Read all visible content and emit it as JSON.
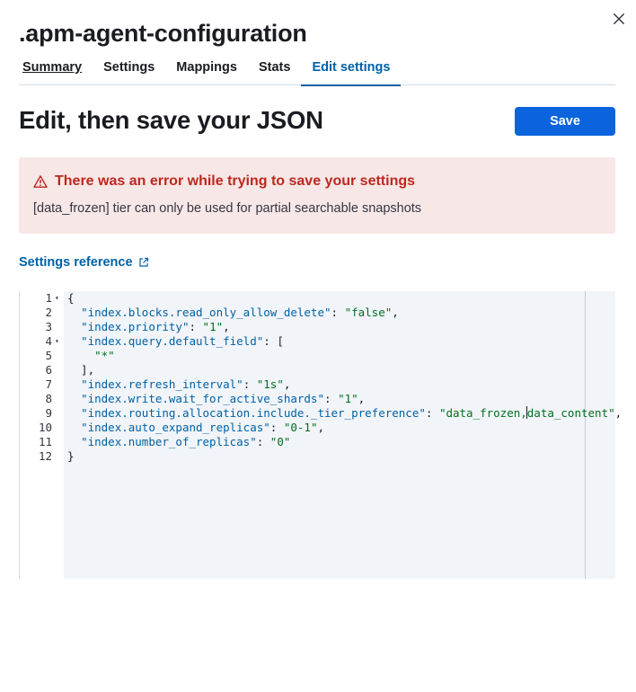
{
  "flyout": {
    "title": ".apm-agent-configuration",
    "close_icon": "close-icon"
  },
  "tabs": [
    {
      "label": "Summary",
      "state": "underlined"
    },
    {
      "label": "Settings",
      "state": "normal"
    },
    {
      "label": "Mappings",
      "state": "normal"
    },
    {
      "label": "Stats",
      "state": "normal"
    },
    {
      "label": "Edit settings",
      "state": "selected"
    }
  ],
  "page": {
    "title": "Edit, then save your JSON",
    "save_label": "Save"
  },
  "error_callout": {
    "icon": "warning-icon",
    "title": "There was an error while trying to save your settings",
    "message": "[data_frozen] tier can only be used for partial searchable snapshots"
  },
  "settings_reference": {
    "label": "Settings reference",
    "icon": "external-link-icon"
  },
  "editor": {
    "lines": [
      {
        "num": "1",
        "fold": true,
        "tokens": [
          [
            "p",
            "{"
          ]
        ]
      },
      {
        "num": "2",
        "fold": false,
        "tokens": [
          [
            "p",
            "  "
          ],
          [
            "k",
            "\"index.blocks.read_only_allow_delete\""
          ],
          [
            "p",
            ": "
          ],
          [
            "s",
            "\"false\""
          ],
          [
            "p",
            ","
          ]
        ]
      },
      {
        "num": "3",
        "fold": false,
        "tokens": [
          [
            "p",
            "  "
          ],
          [
            "k",
            "\"index.priority\""
          ],
          [
            "p",
            ": "
          ],
          [
            "s",
            "\"1\""
          ],
          [
            "p",
            ","
          ]
        ]
      },
      {
        "num": "4",
        "fold": true,
        "tokens": [
          [
            "p",
            "  "
          ],
          [
            "k",
            "\"index.query.default_field\""
          ],
          [
            "p",
            ": ["
          ]
        ]
      },
      {
        "num": "5",
        "fold": false,
        "tokens": [
          [
            "p",
            "    "
          ],
          [
            "s",
            "\"*\""
          ]
        ]
      },
      {
        "num": "6",
        "fold": false,
        "tokens": [
          [
            "p",
            "  ],"
          ]
        ]
      },
      {
        "num": "7",
        "fold": false,
        "tokens": [
          [
            "p",
            "  "
          ],
          [
            "k",
            "\"index.refresh_interval\""
          ],
          [
            "p",
            ": "
          ],
          [
            "s",
            "\"1s\""
          ],
          [
            "p",
            ","
          ]
        ]
      },
      {
        "num": "8",
        "fold": false,
        "tokens": [
          [
            "p",
            "  "
          ],
          [
            "k",
            "\"index.write.wait_for_active_shards\""
          ],
          [
            "p",
            ": "
          ],
          [
            "s",
            "\"1\""
          ],
          [
            "p",
            ","
          ]
        ]
      },
      {
        "num": "9",
        "fold": false,
        "tokens": [
          [
            "p",
            "  "
          ],
          [
            "k",
            "\"index.routing.allocation.include._tier_preference\""
          ],
          [
            "p",
            ": "
          ],
          [
            "s",
            "\"data_frozen,"
          ],
          [
            "cursor",
            ""
          ],
          [
            "s",
            "data_content\""
          ],
          [
            "p",
            ","
          ]
        ]
      },
      {
        "num": "10",
        "fold": false,
        "tokens": [
          [
            "p",
            "  "
          ],
          [
            "k",
            "\"index.auto_expand_replicas\""
          ],
          [
            "p",
            ": "
          ],
          [
            "s",
            "\"0-1\""
          ],
          [
            "p",
            ","
          ]
        ]
      },
      {
        "num": "11",
        "fold": false,
        "tokens": [
          [
            "p",
            "  "
          ],
          [
            "k",
            "\"index.number_of_replicas\""
          ],
          [
            "p",
            ": "
          ],
          [
            "s",
            "\"0\""
          ]
        ]
      },
      {
        "num": "12",
        "fold": false,
        "tokens": [
          [
            "p",
            "}"
          ]
        ]
      }
    ]
  },
  "colors": {
    "accent": "#0061a6",
    "primary_button": "#0b64dd",
    "danger": "#bd271e",
    "danger_bg": "#f8e7e7",
    "json_key": "#0061a6",
    "json_string": "#00701f"
  }
}
